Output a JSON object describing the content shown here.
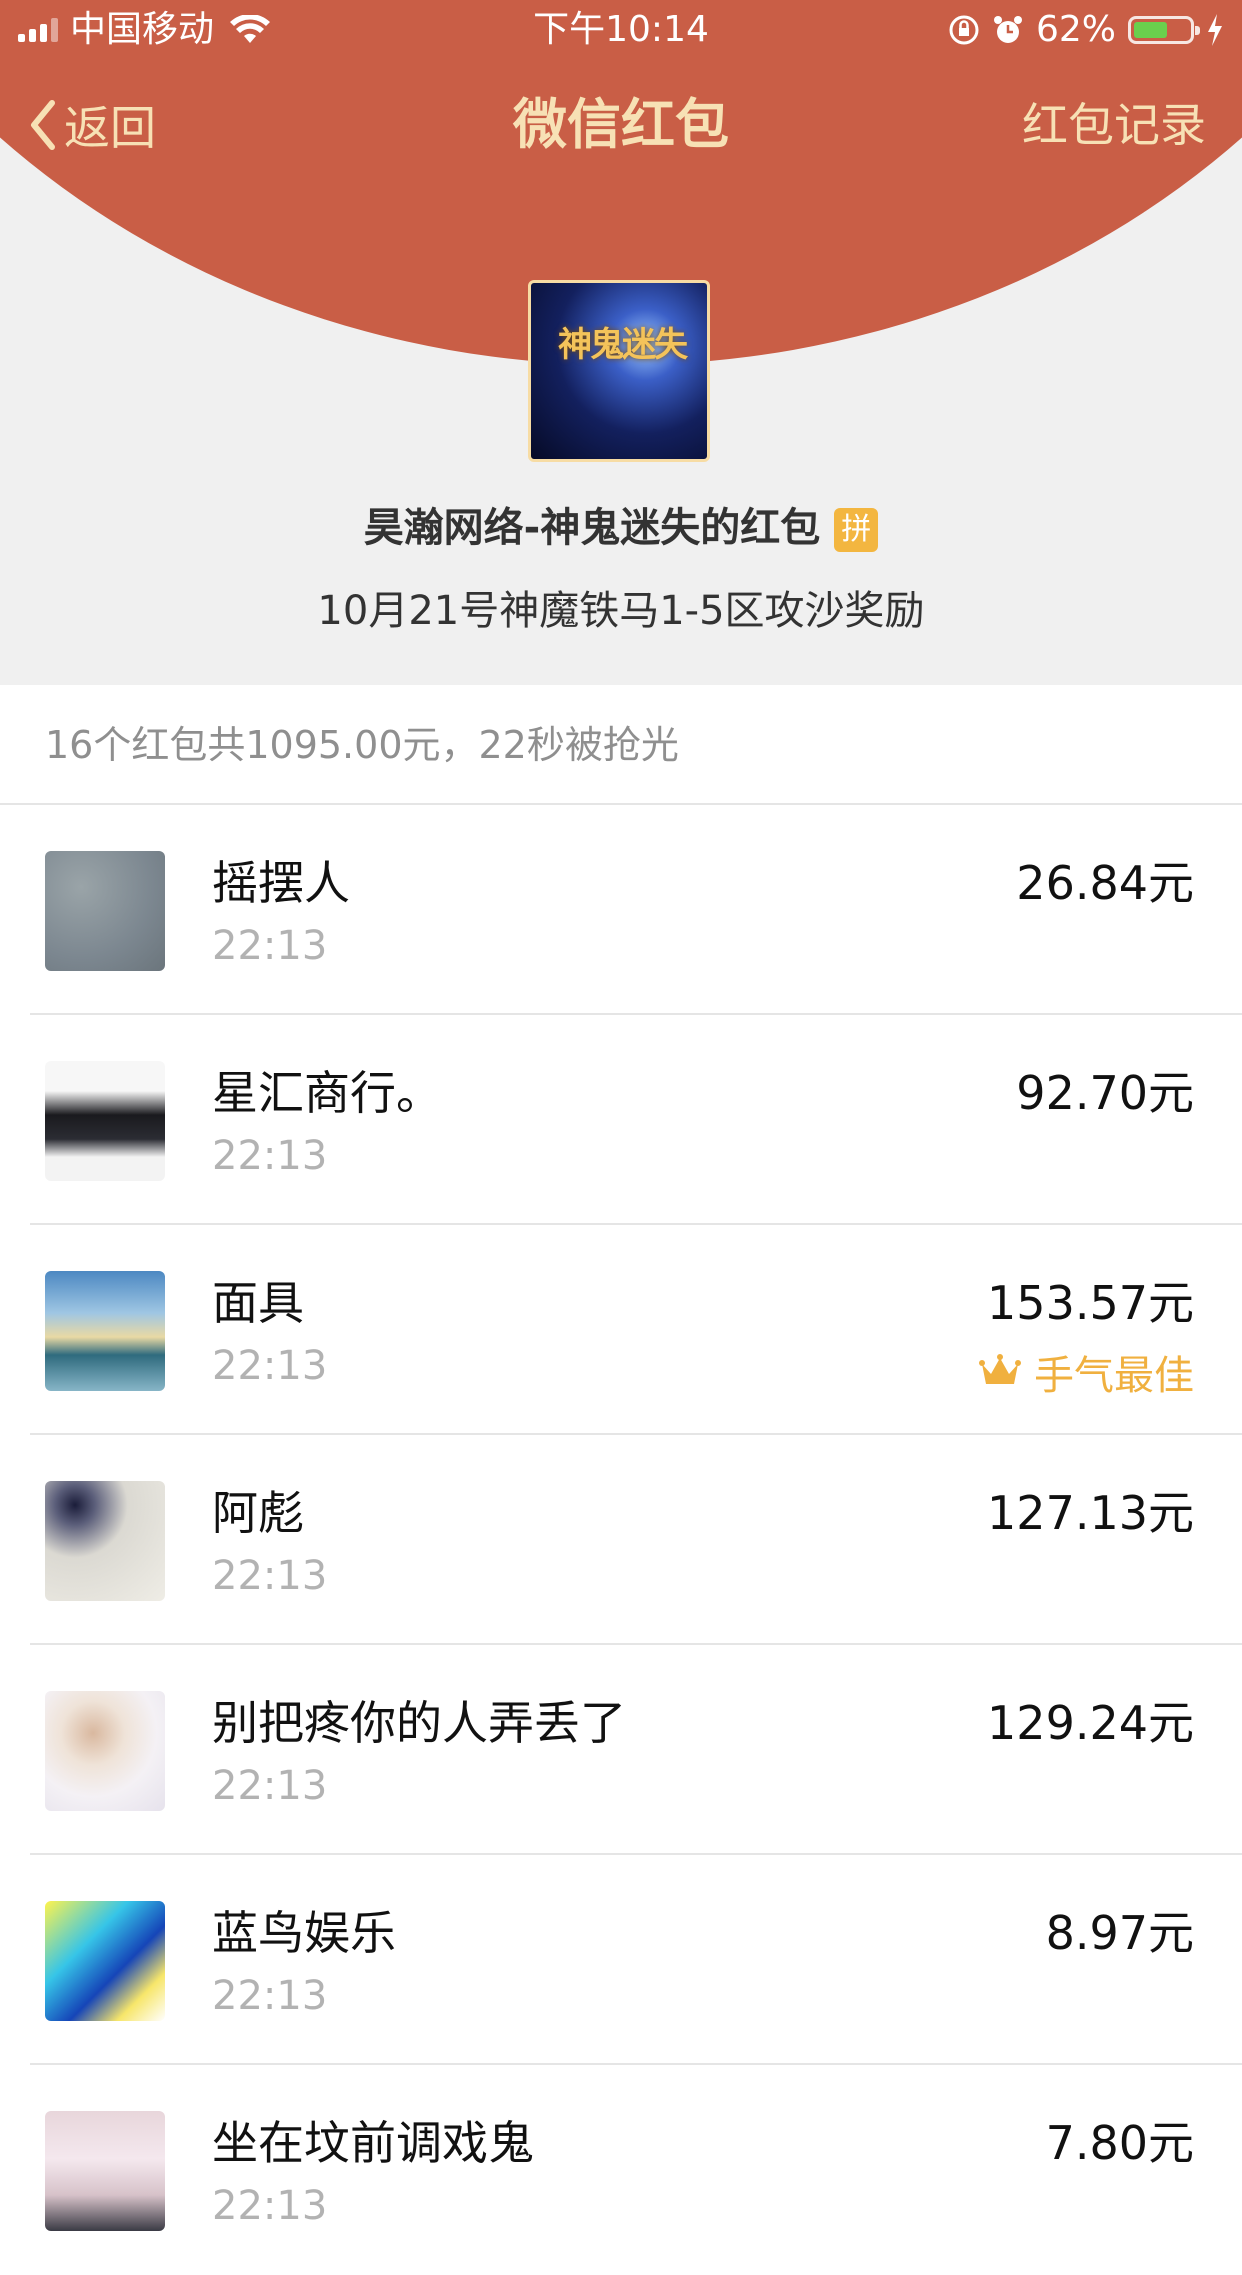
{
  "status_bar": {
    "carrier": "中国移动",
    "time": "下午10:14",
    "battery_percent": "62%",
    "battery_level": 0.62,
    "battery_color": "#6ad04d"
  },
  "nav": {
    "back_label": "返回",
    "title": "微信红包",
    "records_label": "红包记录"
  },
  "colors": {
    "header_red": "#c95e46",
    "gold_text": "#f7e1b5",
    "best_luck": "#f0b03f"
  },
  "packet": {
    "sender_avatar_text": "神鬼迷失",
    "sender": "昊瀚网络-神鬼迷失的红包",
    "badge": "拼",
    "greeting": "10月21号神魔铁马1-5区攻沙奖励"
  },
  "summary": "16个红包共1095.00元，22秒被抢光",
  "recipients": [
    {
      "name": "摇摆人",
      "time": "22:13",
      "amount": "26.84元",
      "best": false
    },
    {
      "name": "星汇商行。",
      "time": "22:13",
      "amount": "92.70元",
      "best": false
    },
    {
      "name": "面具",
      "time": "22:13",
      "amount": "153.57元",
      "best": true,
      "best_label": "手气最佳"
    },
    {
      "name": "阿彪",
      "time": "22:13",
      "amount": "127.13元",
      "best": false
    },
    {
      "name": "别把疼你的人弄丢了",
      "time": "22:13",
      "amount": "129.24元",
      "best": false
    },
    {
      "name": "蓝鸟娱乐",
      "time": "22:13",
      "amount": "8.97元",
      "best": false
    },
    {
      "name": "坐在坟前调戏鬼",
      "time": "22:13",
      "amount": "7.80元",
      "best": false
    }
  ]
}
